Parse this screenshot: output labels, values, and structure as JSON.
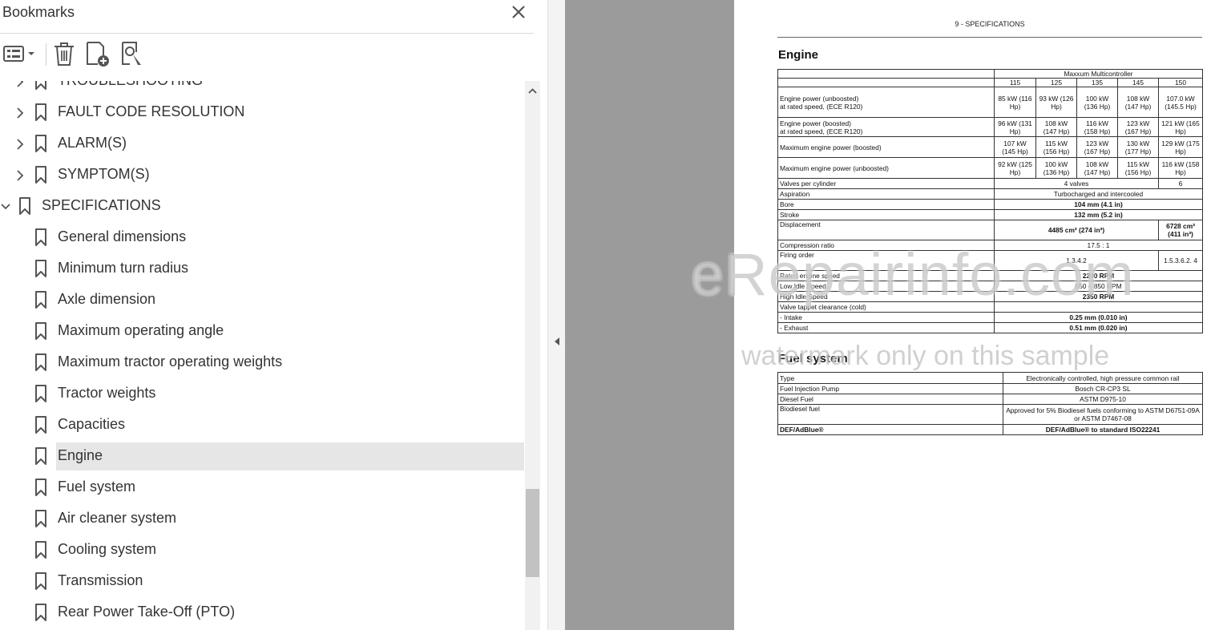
{
  "bookmarks_panel": {
    "title": "Bookmarks",
    "items": [
      {
        "label": "TROUBLESHOOTING",
        "expandable": true
      },
      {
        "label": "FAULT CODE RESOLUTION",
        "expandable": true
      },
      {
        "label": "ALARM(S)",
        "expandable": true
      },
      {
        "label": "SYMPTOM(S)",
        "expandable": true
      },
      {
        "label": "SPECIFICATIONS",
        "expandable": true,
        "expanded": true
      },
      {
        "label": "General dimensions"
      },
      {
        "label": "Minimum turn radius"
      },
      {
        "label": "Axle dimension"
      },
      {
        "label": "Maximum operating angle"
      },
      {
        "label": "Maximum tractor operating weights"
      },
      {
        "label": "Tractor weights"
      },
      {
        "label": "Capacities"
      },
      {
        "label": "Engine",
        "selected": true
      },
      {
        "label": "Fuel system"
      },
      {
        "label": "Air cleaner system"
      },
      {
        "label": "Cooling system"
      },
      {
        "label": "Transmission"
      },
      {
        "label": "Rear Power Take-Off (PTO)"
      }
    ]
  },
  "document": {
    "header": "9 - SPECIFICATIONS",
    "engine_title": "Engine",
    "fuel_title": "Fuel system",
    "engine_table": {
      "model_header": "Maxxum Multicontroller",
      "models": [
        "115",
        "125",
        "135",
        "145",
        "150"
      ],
      "rows": {
        "engine_power_unboosted": {
          "label1": "Engine power (unboosted)",
          "label2": "at rated speed, (ECE R120)",
          "values": [
            "85 kW (116 Hp)",
            "93 kW (126 Hp)",
            "100 kW (136 Hp)",
            "108 kW (147 Hp)",
            "107.0 kW (145.5 Hp)"
          ]
        },
        "engine_power_boosted": {
          "label1": "Engine power (boosted)",
          "label2": "at rated speed, (ECE R120)",
          "values": [
            "96 kW (131 Hp)",
            "108 kW (147 Hp)",
            "116 kW (158 Hp)",
            "123 kW (167 Hp)",
            "121 kW (165 Hp)"
          ]
        },
        "max_power_boosted": {
          "label": "Maximum engine power (boosted)",
          "values": [
            "107 kW (145 Hp)",
            "115 kW (156 Hp)",
            "123 kW (167 Hp)",
            "130 kW (177 Hp)",
            "129 kW (175 Hp)"
          ]
        },
        "max_power_unboosted": {
          "label": "Maximum engine power (unboosted)",
          "values": [
            "92 kW (125 Hp)",
            "100 kW (136 Hp)",
            "108 kW (147 Hp)",
            "115 kW (156 Hp)",
            "116 kW (158 Hp)"
          ]
        },
        "valves": {
          "label": "Valves per cylinder",
          "value": "4 valves",
          "value_150": "6"
        },
        "aspiration": {
          "label": "Aspiration",
          "value": "Turbocharged and intercooled"
        },
        "bore": {
          "label": "Bore",
          "value": "104 mm (4.1 in)"
        },
        "stroke": {
          "label": "Stroke",
          "value": "132 mm (5.2 in)"
        },
        "displacement": {
          "label": "Displacement",
          "value": "4485 cm³ (274 in³)",
          "value_150": "6728 cm³ (411 in³)"
        },
        "compression": {
          "label": "Compression ratio",
          "value": "17.5 : 1"
        },
        "firing_order": {
          "label": "Firing order",
          "value": "1.3.4.2",
          "value_150": "1.5.3.6.2. 4"
        },
        "rated_speed": {
          "label": "Rated engine speed",
          "value": "2200 RPM"
        },
        "low_idle": {
          "label": "Low Idle Speed",
          "value": "650 – 850 RPM"
        },
        "high_idle": {
          "label": "High Idle Speed",
          "value": "2350 RPM"
        },
        "valve_tappet": {
          "label": "Valve tappet clearance (cold)"
        },
        "intake": {
          "label": "- Intake",
          "value": "0.25 mm (0.010 in)"
        },
        "exhaust": {
          "label": "- Exhaust",
          "value": "0.51 mm (0.020 in)"
        }
      }
    },
    "fuel_table": {
      "rows": [
        {
          "label": "Type",
          "value": "Electronically controlled, high pressure common rail"
        },
        {
          "label": "Fuel Injection Pump",
          "value": "Bosch CR-CP3 SL"
        },
        {
          "label": "Diesel Fuel",
          "value": "ASTM D975-10"
        },
        {
          "label": "Biodiesel fuel",
          "value": "Approved for 5% Biodiesel fuels conforming to ASTM D6751-09A or ASTM D7467-08"
        },
        {
          "label": "DEF/AdBlue®",
          "value": "DEF/AdBlue® to standard ISO22241"
        }
      ]
    },
    "watermark_main": "eRepairinfo.com",
    "watermark_sub": "watermark only on this sample"
  },
  "colors": {
    "selected_bg": "#e6e6e6",
    "gray_area": "#9b9b9b",
    "icon": "#555555"
  }
}
